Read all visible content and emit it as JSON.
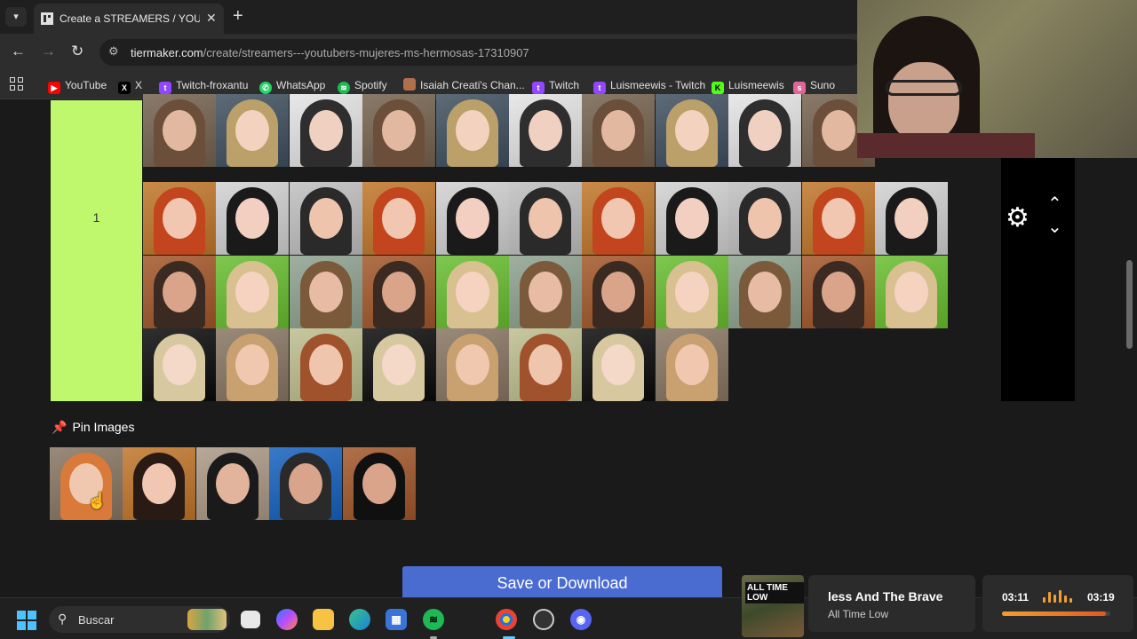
{
  "browser": {
    "tab_title": "Create a STREAMERS / YOUTUBERS",
    "url_domain": "tiermaker.com",
    "url_path": "/create/streamers---youtubers-mujeres-ms-hermosas-17310907",
    "bookmarks": [
      "YouTube",
      "X",
      "Twitch-froxantu",
      "WhatsApp",
      "Spotify",
      "Isaiah Creati's Chan...",
      "Twitch",
      "Luismeewis - Twitch",
      "Luismeewis",
      "Suno"
    ]
  },
  "tier": {
    "label": "1",
    "color": "#bff86c",
    "image_count": 37
  },
  "pin": {
    "heading": "Pin Images",
    "image_count": 5
  },
  "save_button": "Save or Download",
  "taskbar": {
    "search_placeholder": "Buscar"
  },
  "music": {
    "album_text": "ALL TIME LOW",
    "title": "Less And The Brave",
    "title_visible": "less And The Brave",
    "artist": "All Time Low",
    "current_time": "03:11",
    "total_time": "03:19",
    "progress": 0.96
  }
}
